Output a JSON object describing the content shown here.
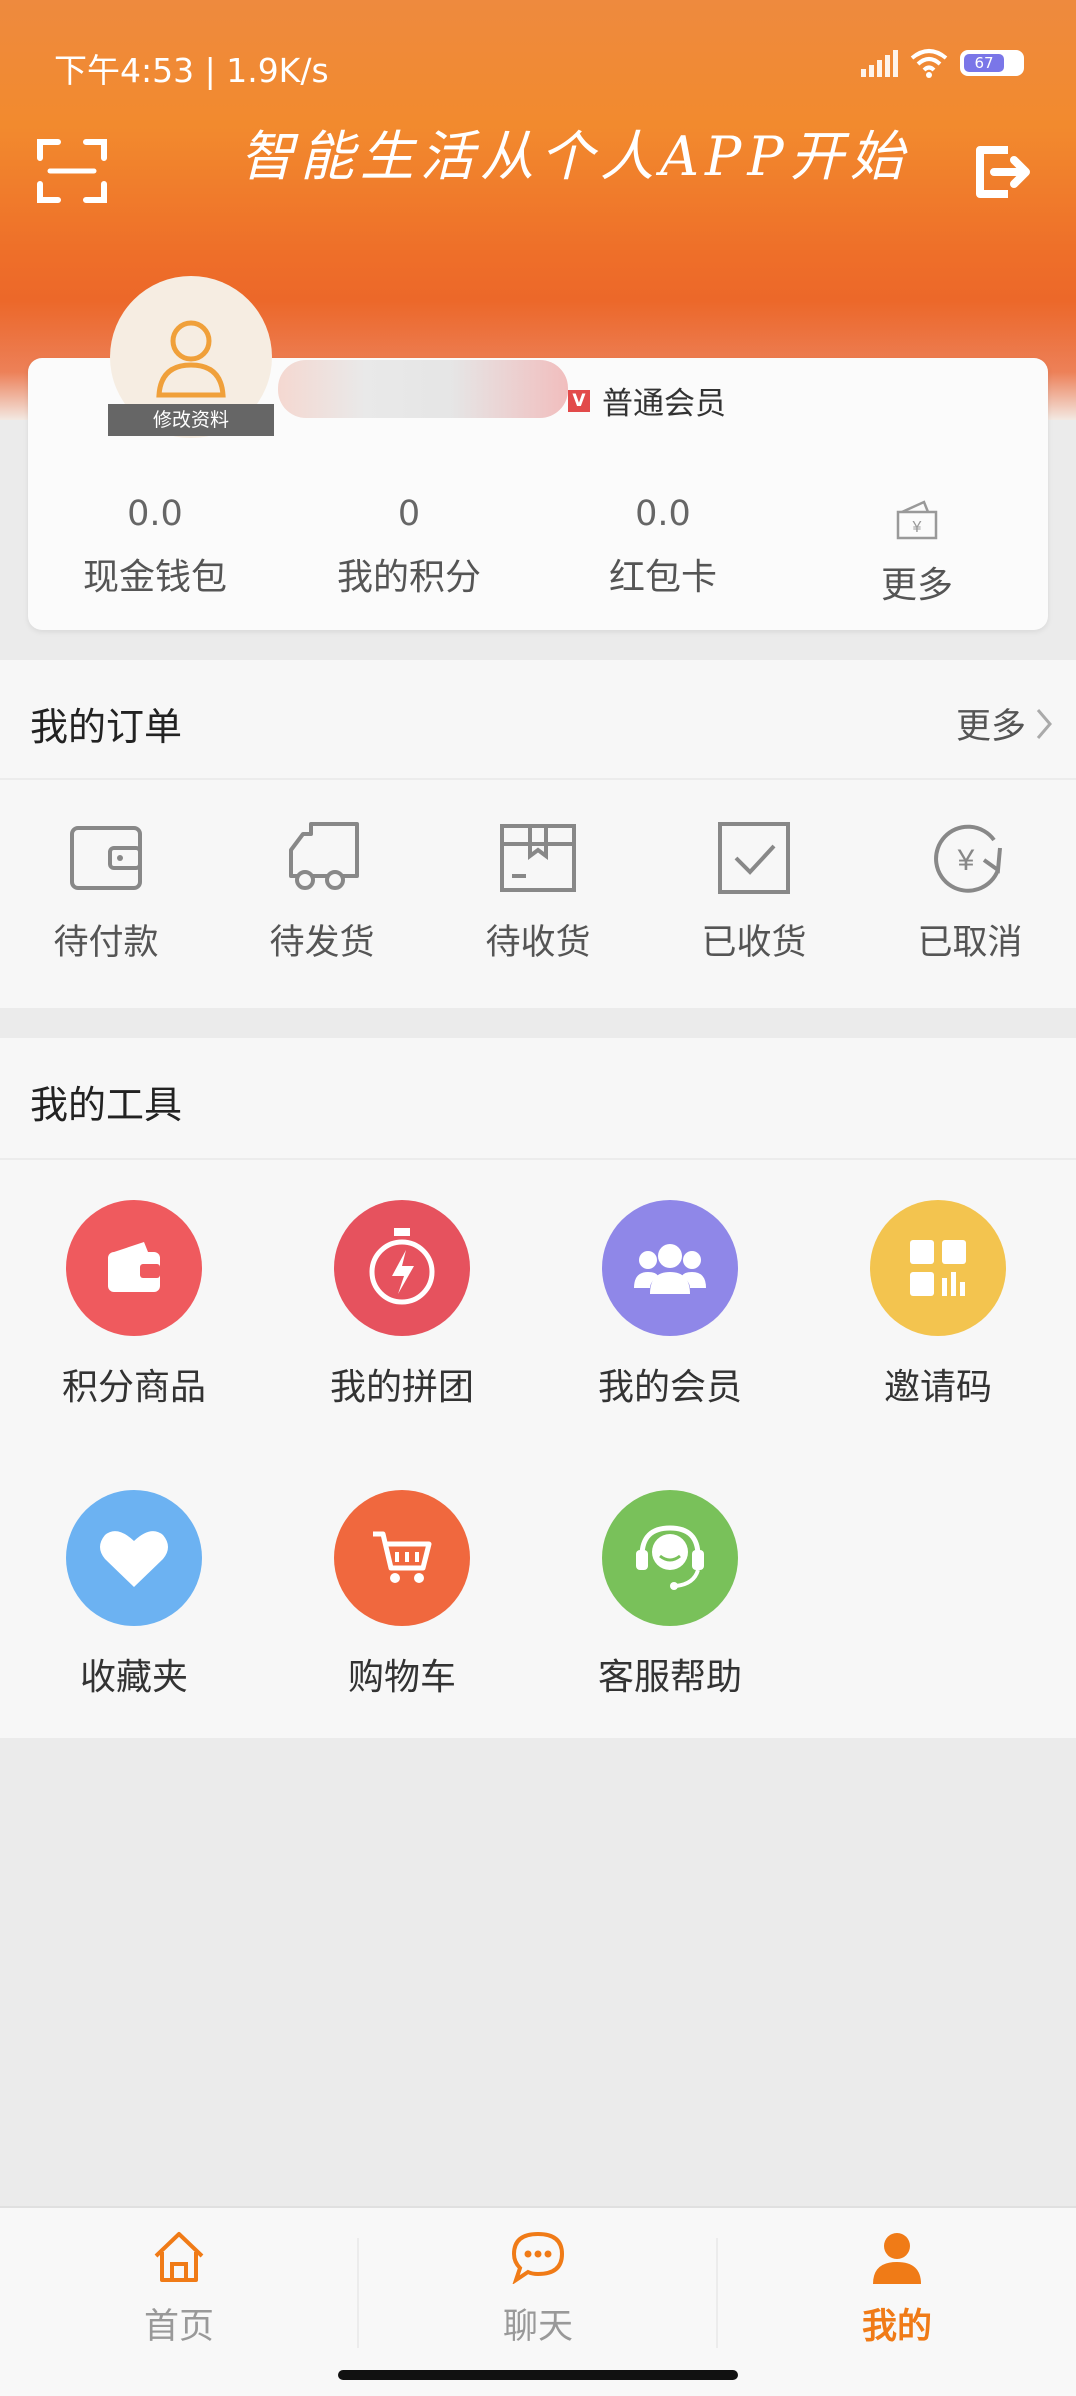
{
  "status_bar": {
    "time_speed": "下午4:53 | 1.9K/s",
    "battery": "67"
  },
  "header": {
    "slogan": "智能生活从个人APP开始"
  },
  "profile": {
    "edit_label": "修改资料",
    "vip_badge": "V",
    "member_level": "普通会员",
    "stats": [
      {
        "value": "0.0",
        "label": "现金钱包"
      },
      {
        "value": "0",
        "label": "我的积分"
      },
      {
        "value": "0.0",
        "label": "红包卡"
      },
      {
        "label": "更多"
      }
    ]
  },
  "orders": {
    "title": "我的订单",
    "more": "更多",
    "items": [
      "待付款",
      "待发货",
      "待收货",
      "已收货",
      "已取消"
    ]
  },
  "tools": {
    "title": "我的工具",
    "items": [
      "积分商品",
      "我的拼团",
      "我的会员",
      "邀请码",
      "收藏夹",
      "购物车",
      "客服帮助"
    ]
  },
  "nav": {
    "items": [
      "首页",
      "聊天",
      "我的"
    ],
    "active": "我的"
  },
  "colors": {
    "accent": "#f07b17",
    "red": "#ef5a5e",
    "purple": "#8f87e8",
    "yellow": "#f3c44f",
    "blue": "#6cb2f2",
    "orange": "#f0683e",
    "green": "#79c15a"
  }
}
